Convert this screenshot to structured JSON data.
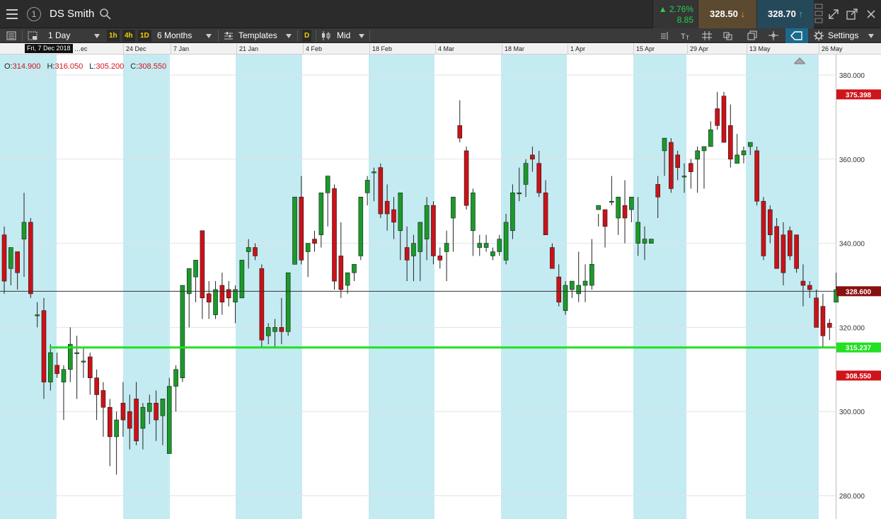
{
  "header": {
    "instrument": "DS Smith",
    "window_number": "1",
    "change_pct": "2.76%",
    "change_abs": "8.85",
    "bid": "328.50",
    "ask": "328.70"
  },
  "toolbar": {
    "interval": "1 Day",
    "quick_1h": "1h",
    "quick_4h": "4h",
    "quick_1d": "1D",
    "range": "6 Months",
    "templates": "Templates",
    "d_badge": "D",
    "price_type": "Mid",
    "settings": "Settings"
  },
  "crosshair_date": "Fri, 7 Dec 2018",
  "ohlc": {
    "o_label": "O:",
    "o": "314.900",
    "h_label": "H:",
    "h": "316.050",
    "l_label": "L:",
    "l": "305.200",
    "c_label": "C:",
    "c": "308.550"
  },
  "colors": {
    "up": "#1a9a2a",
    "down": "#cc1118",
    "shade": "#c4ebf1",
    "support_line": "#22e022",
    "price_tag_red": "#d0141b"
  },
  "chart_data": {
    "type": "candlestick",
    "x_axis_labels": [
      "…ec",
      "24 Dec",
      "7 Jan",
      "21 Jan",
      "4 Feb",
      "18 Feb",
      "4 Mar",
      "18 Mar",
      "1 Apr",
      "15 Apr",
      "29 Apr",
      "13 May",
      "26 May"
    ],
    "y_ticks": [
      "380.000",
      "360.000",
      "340.000",
      "320.000",
      "300.000",
      "280.000"
    ],
    "ylim": [
      276,
      386
    ],
    "price_tags": [
      {
        "label": "375.398",
        "value": 375.398,
        "style": "red"
      },
      {
        "label": "328.600",
        "value": 328.6,
        "style": "darkred"
      },
      {
        "label": "315.237",
        "value": 315.237,
        "style": "green"
      },
      {
        "label": "308.550",
        "value": 308.55,
        "style": "red"
      }
    ],
    "horizontal_lines": [
      {
        "value": 328.6,
        "style": "crosshair"
      },
      {
        "value": 315.237,
        "style": "support"
      }
    ],
    "candles": [
      [
        342,
        344,
        328,
        331
      ],
      [
        334,
        339,
        330,
        339
      ],
      [
        338,
        338,
        329,
        333
      ],
      [
        341,
        352,
        332,
        345
      ],
      [
        345,
        346,
        327,
        328
      ],
      [
        323,
        326,
        320,
        323
      ],
      [
        324,
        327,
        303,
        307
      ],
      [
        307,
        316,
        305,
        314
      ],
      [
        311,
        314,
        308,
        309
      ],
      [
        307,
        311,
        298,
        310
      ],
      [
        310,
        320,
        307,
        316
      ],
      [
        314,
        318,
        303,
        314
      ],
      [
        312,
        315,
        308,
        312
      ],
      [
        313,
        314,
        304,
        308
      ],
      [
        308,
        310,
        298,
        304
      ],
      [
        305,
        307,
        294,
        301
      ],
      [
        301,
        303,
        287,
        294
      ],
      [
        294,
        300,
        285,
        298
      ],
      [
        302,
        307,
        294,
        298
      ],
      [
        300,
        304,
        291,
        296
      ],
      [
        303,
        307,
        292,
        293
      ],
      [
        296,
        302,
        291,
        301
      ],
      [
        300,
        304,
        297,
        302
      ],
      [
        302,
        305,
        293,
        298
      ],
      [
        299,
        303,
        292,
        303
      ],
      [
        290,
        308,
        290,
        306
      ],
      [
        306,
        311,
        300,
        310
      ],
      [
        308,
        330,
        307,
        330
      ],
      [
        328,
        334,
        320,
        334
      ],
      [
        332,
        336,
        326,
        336
      ],
      [
        343,
        343,
        322,
        327
      ],
      [
        328,
        331,
        322,
        326
      ],
      [
        323,
        331,
        322,
        329
      ],
      [
        330,
        333,
        323,
        326
      ],
      [
        329,
        331,
        325,
        327
      ],
      [
        326,
        330,
        321,
        329
      ],
      [
        327,
        336,
        327,
        336
      ],
      [
        338,
        341,
        334,
        339
      ],
      [
        339,
        340,
        336,
        337
      ],
      [
        334,
        335,
        315,
        317
      ],
      [
        318,
        321,
        316,
        320
      ],
      [
        319,
        322,
        315,
        320
      ],
      [
        320,
        327,
        316,
        319
      ],
      [
        319,
        333,
        318,
        333
      ],
      [
        335,
        351,
        335,
        351
      ],
      [
        351,
        356,
        335,
        336
      ],
      [
        338,
        339,
        332,
        340
      ],
      [
        341,
        343,
        338,
        340
      ],
      [
        342,
        352,
        339,
        352
      ],
      [
        352,
        356,
        344,
        356
      ],
      [
        353,
        354,
        329,
        331
      ],
      [
        337,
        345,
        327,
        329
      ],
      [
        330,
        332,
        328,
        333
      ],
      [
        333,
        335,
        331,
        335
      ],
      [
        337,
        351,
        336,
        351
      ],
      [
        352,
        356,
        349,
        355
      ],
      [
        357,
        358,
        350,
        357
      ],
      [
        358,
        359,
        346,
        347
      ],
      [
        350,
        354,
        343,
        347
      ],
      [
        348,
        351,
        341,
        345
      ],
      [
        343,
        348,
        336,
        352
      ],
      [
        339,
        344,
        331,
        336
      ],
      [
        337,
        342,
        331,
        340
      ],
      [
        338,
        342,
        331,
        345
      ],
      [
        341,
        351,
        336,
        349
      ],
      [
        349,
        350,
        335,
        337
      ],
      [
        337,
        339,
        334,
        336
      ],
      [
        338,
        343,
        331,
        340
      ],
      [
        346,
        347,
        338,
        351
      ],
      [
        368,
        374,
        364,
        365
      ],
      [
        362,
        363,
        348,
        349
      ],
      [
        343,
        353,
        337,
        352
      ],
      [
        339,
        342,
        337,
        340
      ],
      [
        339,
        342,
        338,
        340
      ],
      [
        337,
        339,
        336,
        338
      ],
      [
        338,
        342,
        337,
        341
      ],
      [
        336,
        347,
        335,
        345
      ],
      [
        343,
        354,
        341,
        352
      ],
      [
        352,
        358,
        350,
        352
      ],
      [
        354,
        360,
        351,
        359
      ],
      [
        361,
        363,
        357,
        360
      ],
      [
        359,
        362,
        351,
        352
      ],
      [
        352,
        355,
        352,
        342
      ],
      [
        339,
        340,
        334,
        334
      ],
      [
        332,
        335,
        325,
        326
      ],
      [
        324,
        331,
        323,
        330
      ],
      [
        329,
        331,
        327,
        331
      ],
      [
        328,
        338,
        326,
        330
      ],
      [
        330,
        335,
        326,
        331
      ],
      [
        330,
        341,
        329,
        335
      ],
      [
        348,
        347,
        344,
        349
      ],
      [
        348,
        348,
        339,
        344
      ],
      [
        350,
        356,
        349,
        350
      ],
      [
        346,
        349,
        342,
        351
      ],
      [
        349,
        355,
        340,
        346
      ],
      [
        348,
        351,
        345,
        351
      ],
      [
        340,
        351,
        337,
        345
      ],
      [
        340,
        344,
        336,
        341
      ],
      [
        340,
        342,
        342,
        341
      ],
      [
        354,
        356,
        346,
        351
      ],
      [
        362,
        365,
        356,
        365
      ],
      [
        364,
        365,
        352,
        353
      ],
      [
        361,
        362,
        355,
        358
      ],
      [
        356,
        359,
        352,
        356
      ],
      [
        359,
        360,
        353,
        357
      ],
      [
        360,
        363,
        352,
        362
      ],
      [
        362,
        362,
        353,
        363
      ],
      [
        363,
        369,
        363,
        367
      ],
      [
        372,
        376,
        367,
        368
      ],
      [
        375,
        376,
        364,
        364
      ],
      [
        368,
        373,
        358,
        360
      ],
      [
        359,
        366,
        359,
        361
      ],
      [
        361,
        363,
        359,
        362
      ],
      [
        363,
        364,
        361,
        364
      ],
      [
        362,
        363,
        349,
        350
      ],
      [
        350,
        351,
        336,
        337
      ],
      [
        348,
        349,
        340,
        342
      ],
      [
        344,
        346,
        336,
        334
      ],
      [
        342,
        345,
        330,
        333
      ],
      [
        343,
        344,
        336,
        337
      ],
      [
        342,
        342,
        333,
        334
      ],
      [
        331,
        335,
        325,
        330
      ],
      [
        330,
        331,
        327,
        329
      ],
      [
        327,
        329,
        322,
        320
      ],
      [
        325,
        328,
        315,
        318
      ],
      [
        321,
        322,
        317,
        320
      ],
      [
        326,
        333,
        326,
        329
      ]
    ]
  }
}
